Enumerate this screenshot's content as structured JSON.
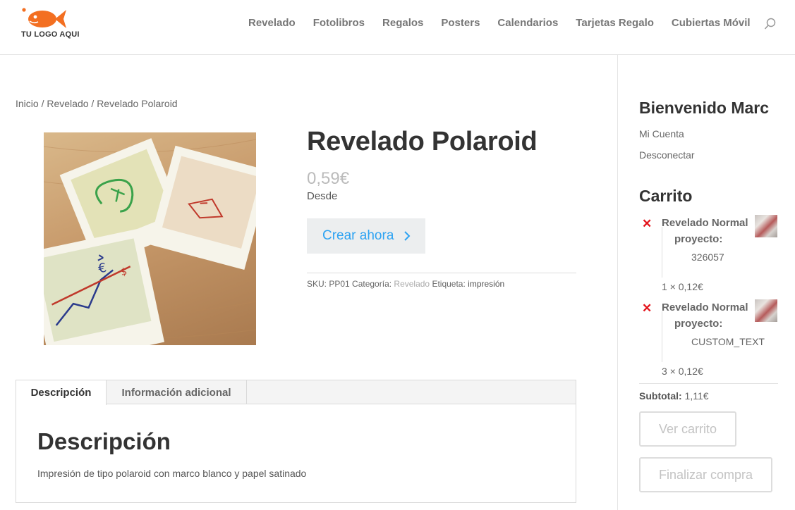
{
  "header": {
    "logo_text": "TU LOGO AQUI",
    "brand_color": "#f36f21",
    "nav": [
      "Revelado",
      "Fotolibros",
      "Regalos",
      "Posters",
      "Calendarios",
      "Tarjetas Regalo",
      "Cubiertas Móvil"
    ]
  },
  "breadcrumb": {
    "home": "Inicio",
    "sep1": " / ",
    "category": "Revelado",
    "sep2": " / ",
    "current": "Revelado Polaroid"
  },
  "product": {
    "title": "Revelado Polaroid",
    "price": "0,59€",
    "price_note": "Desde",
    "create_button": "Crear ahora",
    "sku_label": "SKU: ",
    "sku": "PP01",
    "category_label": " Categoría: ",
    "category": "Revelado",
    "tag_label": " Etiqueta: ",
    "tag": "impresión",
    "accent_color": "#2ea3f2"
  },
  "tabs": {
    "items": [
      "Descripción",
      "Información adicional"
    ],
    "panel_title": "Descripción",
    "panel_text": "Impresión de tipo polaroid con marco blanco y papel satinado"
  },
  "sidebar": {
    "welcome": "Bienvenido Marc",
    "links": [
      "Mi Cuenta",
      "Desconectar"
    ],
    "cart_title": "Carrito",
    "cart_items": [
      {
        "name": "Revelado Normal",
        "project_label": "proyecto:",
        "project_value": "326057",
        "qty_price": "1 × 0,12€"
      },
      {
        "name": "Revelado Normal",
        "project_label": "proyecto:",
        "project_value": "CUSTOM_TEXT",
        "qty_price": "3 × 0,12€"
      }
    ],
    "subtotal_label": "Subtotal:",
    "subtotal_value": " 1,11€",
    "view_cart": "Ver carrito",
    "checkout": "Finalizar compra"
  }
}
